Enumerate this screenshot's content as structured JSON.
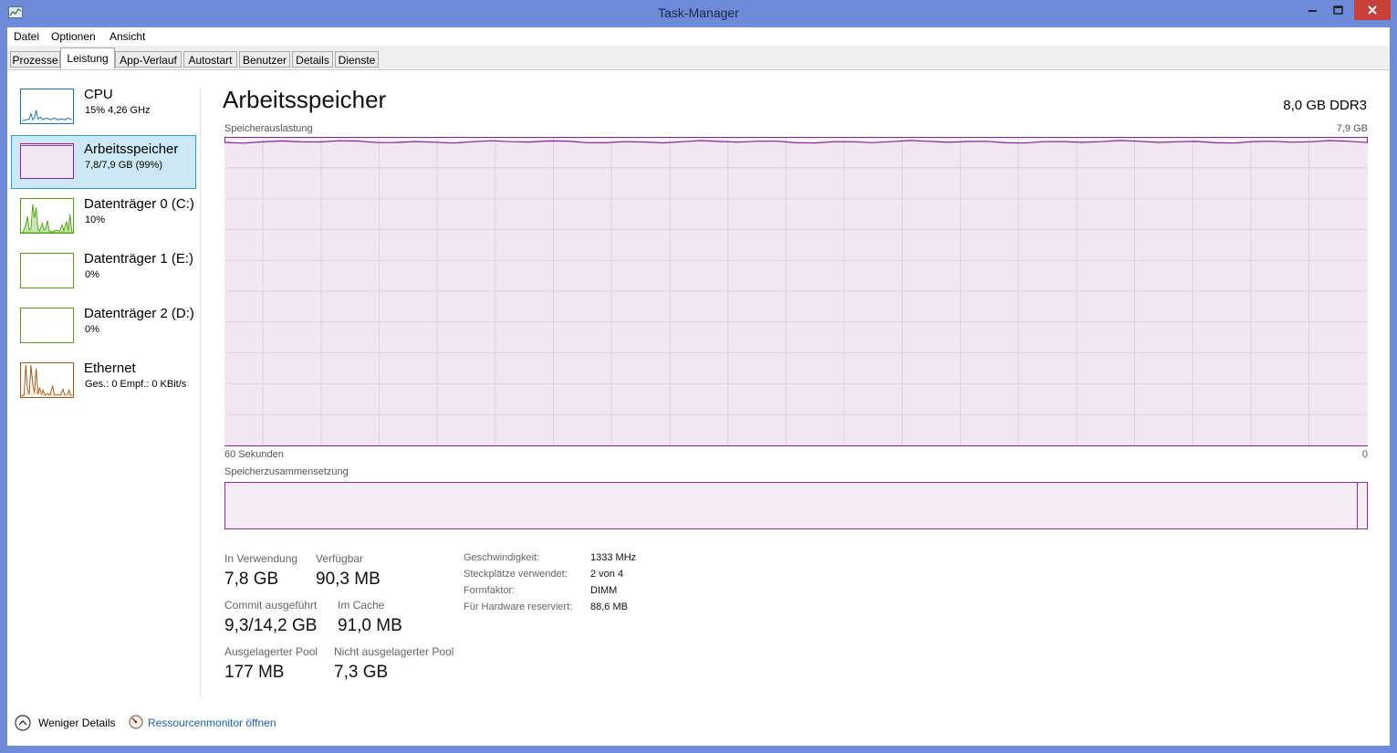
{
  "window": {
    "title": "Task-Manager",
    "icon": "task-manager-icon",
    "controls": [
      "minimize-icon",
      "maximize-icon",
      "close-icon"
    ]
  },
  "menu": [
    "Datei",
    "Optionen",
    "Ansicht"
  ],
  "tabs": [
    {
      "label": "Prozesse",
      "active": false
    },
    {
      "label": "Leistung",
      "active": true
    },
    {
      "label": "App-Verlauf",
      "active": false
    },
    {
      "label": "Autostart",
      "active": false
    },
    {
      "label": "Benutzer",
      "active": false
    },
    {
      "label": "Details",
      "active": false
    },
    {
      "label": "Dienste",
      "active": false
    }
  ],
  "sidebar": [
    {
      "name": "CPU",
      "sub": "15%  4,26 GHz",
      "color": "#1171b6",
      "selected": false
    },
    {
      "name": "Arbeitsspeicher",
      "sub": "7,8/7,9 GB (99%)",
      "color": "#8b1d9e",
      "selected": true
    },
    {
      "name": "Datenträger 0 (C:)",
      "sub": "10%",
      "color": "#4da60c",
      "selected": false
    },
    {
      "name": "Datenträger 1 (E:)",
      "sub": "0%",
      "color": "#4da60c",
      "selected": false
    },
    {
      "name": "Datenträger 2 (D:)",
      "sub": "0%",
      "color": "#4da60c",
      "selected": false
    },
    {
      "name": "Ethernet",
      "sub": "Ges.: 0  Empf.: 0 KBit/s",
      "color": "#a7540c",
      "selected": false
    }
  ],
  "main": {
    "title": "Arbeitsspeicher",
    "subtitle": "8,0 GB DDR3",
    "usage_label": "Speicherauslastung",
    "usage_max": "7,9 GB",
    "time_left": "60 Sekunden",
    "time_right": "0",
    "composition_label": "Speicherzusammensetzung",
    "usage_fraction": 0.99
  },
  "stats": {
    "in_use_label": "In Verwendung",
    "in_use": "7,8 GB",
    "available_label": "Verfügbar",
    "available": "90,3 MB",
    "commit_label": "Commit ausgeführt",
    "commit": "9,3/14,2 GB",
    "cached_label": "Im Cache",
    "cached": "91,0 MB",
    "paged_label": "Ausgelagerter Pool",
    "paged": "177 MB",
    "nonpaged_label": "Nicht ausgelagerter Pool",
    "nonpaged": "7,3 GB"
  },
  "specs": [
    {
      "k": "Geschwindigkeit:",
      "v": "1333 MHz"
    },
    {
      "k": "Steckplätze verwendet:",
      "v": "2 von 4"
    },
    {
      "k": "Formfaktor:",
      "v": "DIMM"
    },
    {
      "k": "Für Hardware reserviert:",
      "v": "88,6 MB"
    }
  ],
  "footer": {
    "fewer_details": "Weniger Details",
    "resource_monitor": "Ressourcenmonitor öffnen"
  }
}
